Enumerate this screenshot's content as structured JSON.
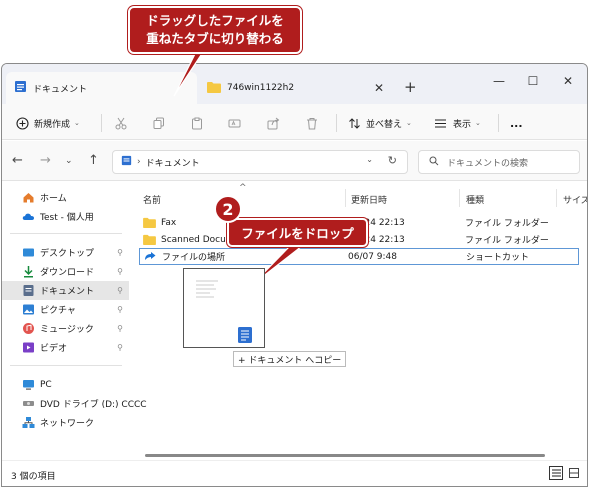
{
  "callouts": {
    "top_line1": "ドラッグしたファイルを",
    "top_line2": "重ねたタブに切り替わる",
    "drop_label": "ファイルをドロップ",
    "step_number": "2",
    "accent_color": "#b01d1d"
  },
  "tabs": [
    {
      "label": "ドキュメント",
      "close": "✕",
      "icon": "documents-icon"
    },
    {
      "label": "746win1122h2",
      "close": "✕",
      "icon": "folder-icon"
    }
  ],
  "new_tab": "+",
  "window_controls": {
    "minimize": "—",
    "maximize": "☐",
    "close": "✕"
  },
  "toolbar": {
    "new_label": "新規作成",
    "sort_label": "並べ替え",
    "view_label": "表示",
    "more_label": "..."
  },
  "address": {
    "path_label": "ドキュメント",
    "search_placeholder": "ドキュメントの検索"
  },
  "sidebar": {
    "items": [
      {
        "label": "ホーム",
        "icon": "home-icon"
      },
      {
        "label": "Test - 個人用",
        "icon": "cloud-icon"
      },
      {
        "label": "デスクトップ",
        "icon": "desktop-icon",
        "pinned": true
      },
      {
        "label": "ダウンロード",
        "icon": "download-icon",
        "pinned": true
      },
      {
        "label": "ドキュメント",
        "icon": "documents-icon",
        "pinned": true,
        "selected": true
      },
      {
        "label": "ピクチャ",
        "icon": "pictures-icon",
        "pinned": true
      },
      {
        "label": "ミュージック",
        "icon": "music-icon",
        "pinned": true
      },
      {
        "label": "ビデオ",
        "icon": "video-icon",
        "pinned": true
      },
      {
        "label": "PC",
        "icon": "pc-icon"
      },
      {
        "label": "DVD ドライブ (D:) CCCC",
        "icon": "dvd-icon"
      },
      {
        "label": "ネットワーク",
        "icon": "network-icon"
      }
    ],
    "pin_glyph": "📌"
  },
  "columns": {
    "name": "名前",
    "modified": "更新日時",
    "type": "種類",
    "size": "サイズ"
  },
  "files": [
    {
      "name": "Fax",
      "date": "/10/24 22:13",
      "type": "ファイル フォルダー",
      "icon": "folder-icon"
    },
    {
      "name": "Scanned Docun",
      "date": "/10/24 22:13",
      "type": "ファイル フォルダー",
      "icon": "folder-icon"
    },
    {
      "name": "ファイルの場所",
      "date": "06/07 9:48",
      "type": "ショートカット",
      "icon": "shortcut-icon"
    }
  ],
  "drag": {
    "tooltip": "+ ドキュメント へコピー"
  },
  "status": {
    "item_count": "3 個の項目"
  }
}
